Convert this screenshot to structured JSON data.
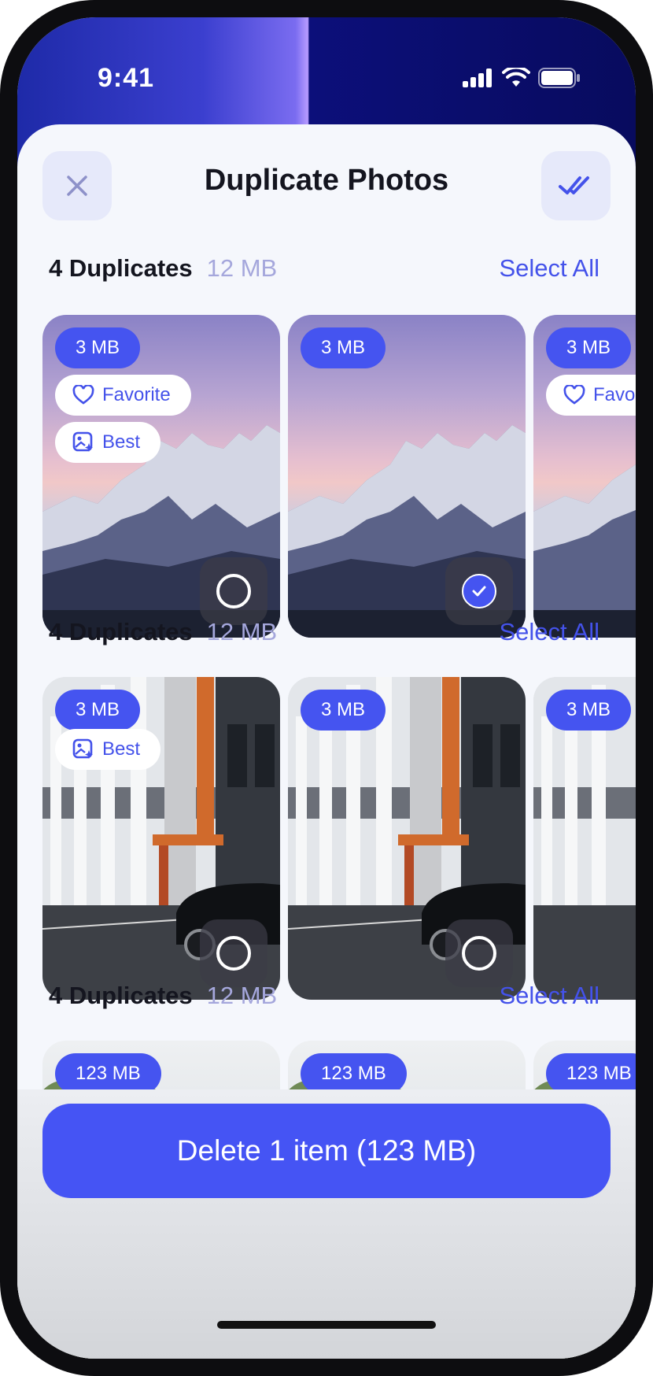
{
  "status_bar": {
    "time": "9:41"
  },
  "header": {
    "title": "Duplicate Photos",
    "close_icon": "close-icon",
    "select_icon": "double-check-icon"
  },
  "groups": [
    {
      "count": "4 Duplicates",
      "size": "12 MB",
      "select_all": "Select All",
      "photos": [
        {
          "size": "3 MB",
          "tags": [
            "Favorite",
            "Best"
          ],
          "selected": false
        },
        {
          "size": "3 MB",
          "tags": [],
          "selected": true
        },
        {
          "size": "3 MB",
          "tags": [
            "Favorite"
          ],
          "selected": false
        }
      ]
    },
    {
      "count": "4 Duplicates",
      "size": "12 MB",
      "select_all": "Select All",
      "photos": [
        {
          "size": "3 MB",
          "tags": [
            "Best"
          ],
          "selected": false
        },
        {
          "size": "3 MB",
          "tags": [],
          "selected": false
        },
        {
          "size": "3 MB",
          "tags": [],
          "selected": false
        }
      ]
    },
    {
      "count": "4 Duplicates",
      "size": "12 MB",
      "select_all": "Select All",
      "photos": [
        {
          "size": "123 MB",
          "tags": []
        },
        {
          "size": "123 MB",
          "tags": []
        },
        {
          "size": "123 MB",
          "tags": []
        }
      ]
    }
  ],
  "footer": {
    "delete_label": "Delete 1 item (123 MB)"
  },
  "colors": {
    "accent": "#4554F0",
    "muted": "#A5A7DC"
  }
}
